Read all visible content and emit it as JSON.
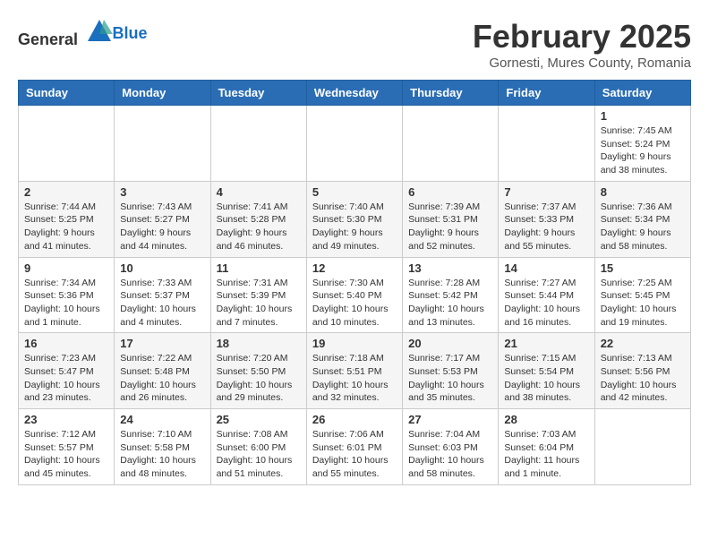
{
  "header": {
    "logo_general": "General",
    "logo_blue": "Blue",
    "month": "February 2025",
    "location": "Gornesti, Mures County, Romania"
  },
  "weekdays": [
    "Sunday",
    "Monday",
    "Tuesday",
    "Wednesday",
    "Thursday",
    "Friday",
    "Saturday"
  ],
  "weeks": [
    [
      {
        "day": "",
        "info": ""
      },
      {
        "day": "",
        "info": ""
      },
      {
        "day": "",
        "info": ""
      },
      {
        "day": "",
        "info": ""
      },
      {
        "day": "",
        "info": ""
      },
      {
        "day": "",
        "info": ""
      },
      {
        "day": "1",
        "info": "Sunrise: 7:45 AM\nSunset: 5:24 PM\nDaylight: 9 hours\nand 38 minutes."
      }
    ],
    [
      {
        "day": "2",
        "info": "Sunrise: 7:44 AM\nSunset: 5:25 PM\nDaylight: 9 hours\nand 41 minutes."
      },
      {
        "day": "3",
        "info": "Sunrise: 7:43 AM\nSunset: 5:27 PM\nDaylight: 9 hours\nand 44 minutes."
      },
      {
        "day": "4",
        "info": "Sunrise: 7:41 AM\nSunset: 5:28 PM\nDaylight: 9 hours\nand 46 minutes."
      },
      {
        "day": "5",
        "info": "Sunrise: 7:40 AM\nSunset: 5:30 PM\nDaylight: 9 hours\nand 49 minutes."
      },
      {
        "day": "6",
        "info": "Sunrise: 7:39 AM\nSunset: 5:31 PM\nDaylight: 9 hours\nand 52 minutes."
      },
      {
        "day": "7",
        "info": "Sunrise: 7:37 AM\nSunset: 5:33 PM\nDaylight: 9 hours\nand 55 minutes."
      },
      {
        "day": "8",
        "info": "Sunrise: 7:36 AM\nSunset: 5:34 PM\nDaylight: 9 hours\nand 58 minutes."
      }
    ],
    [
      {
        "day": "9",
        "info": "Sunrise: 7:34 AM\nSunset: 5:36 PM\nDaylight: 10 hours\nand 1 minute."
      },
      {
        "day": "10",
        "info": "Sunrise: 7:33 AM\nSunset: 5:37 PM\nDaylight: 10 hours\nand 4 minutes."
      },
      {
        "day": "11",
        "info": "Sunrise: 7:31 AM\nSunset: 5:39 PM\nDaylight: 10 hours\nand 7 minutes."
      },
      {
        "day": "12",
        "info": "Sunrise: 7:30 AM\nSunset: 5:40 PM\nDaylight: 10 hours\nand 10 minutes."
      },
      {
        "day": "13",
        "info": "Sunrise: 7:28 AM\nSunset: 5:42 PM\nDaylight: 10 hours\nand 13 minutes."
      },
      {
        "day": "14",
        "info": "Sunrise: 7:27 AM\nSunset: 5:44 PM\nDaylight: 10 hours\nand 16 minutes."
      },
      {
        "day": "15",
        "info": "Sunrise: 7:25 AM\nSunset: 5:45 PM\nDaylight: 10 hours\nand 19 minutes."
      }
    ],
    [
      {
        "day": "16",
        "info": "Sunrise: 7:23 AM\nSunset: 5:47 PM\nDaylight: 10 hours\nand 23 minutes."
      },
      {
        "day": "17",
        "info": "Sunrise: 7:22 AM\nSunset: 5:48 PM\nDaylight: 10 hours\nand 26 minutes."
      },
      {
        "day": "18",
        "info": "Sunrise: 7:20 AM\nSunset: 5:50 PM\nDaylight: 10 hours\nand 29 minutes."
      },
      {
        "day": "19",
        "info": "Sunrise: 7:18 AM\nSunset: 5:51 PM\nDaylight: 10 hours\nand 32 minutes."
      },
      {
        "day": "20",
        "info": "Sunrise: 7:17 AM\nSunset: 5:53 PM\nDaylight: 10 hours\nand 35 minutes."
      },
      {
        "day": "21",
        "info": "Sunrise: 7:15 AM\nSunset: 5:54 PM\nDaylight: 10 hours\nand 38 minutes."
      },
      {
        "day": "22",
        "info": "Sunrise: 7:13 AM\nSunset: 5:56 PM\nDaylight: 10 hours\nand 42 minutes."
      }
    ],
    [
      {
        "day": "23",
        "info": "Sunrise: 7:12 AM\nSunset: 5:57 PM\nDaylight: 10 hours\nand 45 minutes."
      },
      {
        "day": "24",
        "info": "Sunrise: 7:10 AM\nSunset: 5:58 PM\nDaylight: 10 hours\nand 48 minutes."
      },
      {
        "day": "25",
        "info": "Sunrise: 7:08 AM\nSunset: 6:00 PM\nDaylight: 10 hours\nand 51 minutes."
      },
      {
        "day": "26",
        "info": "Sunrise: 7:06 AM\nSunset: 6:01 PM\nDaylight: 10 hours\nand 55 minutes."
      },
      {
        "day": "27",
        "info": "Sunrise: 7:04 AM\nSunset: 6:03 PM\nDaylight: 10 hours\nand 58 minutes."
      },
      {
        "day": "28",
        "info": "Sunrise: 7:03 AM\nSunset: 6:04 PM\nDaylight: 11 hours\nand 1 minute."
      },
      {
        "day": "",
        "info": ""
      }
    ]
  ]
}
